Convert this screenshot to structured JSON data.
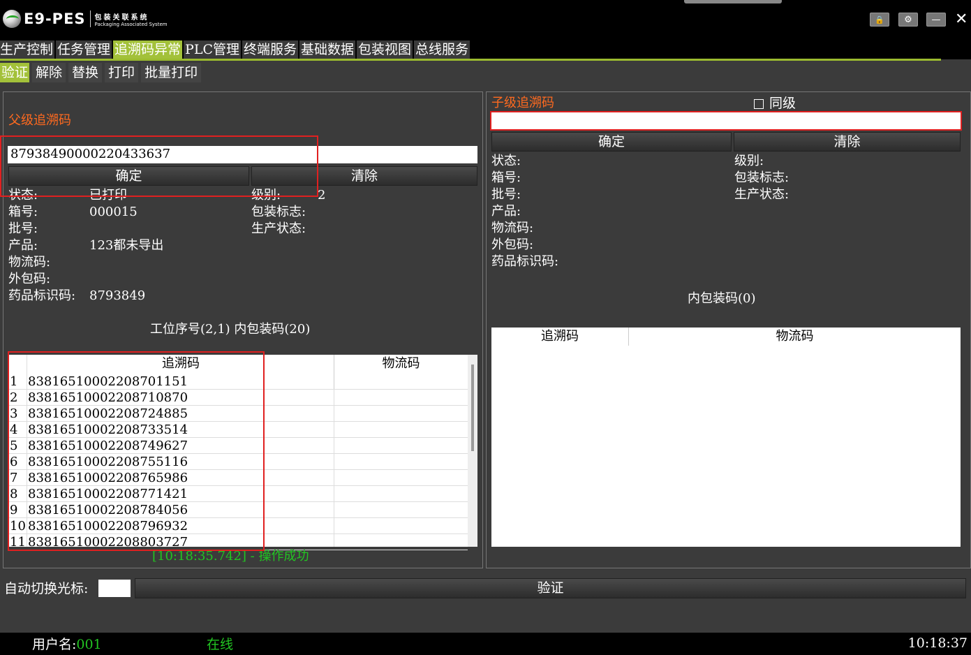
{
  "app": {
    "logo_text": "E9-PES",
    "logo_sub_cn": "包装关联系统",
    "logo_sub_en": "Packaging Associated System"
  },
  "window_controls": {
    "lock": "🔒",
    "settings": "⚙",
    "minimize": "—",
    "close": "✕"
  },
  "main_tabs": [
    "生产控制",
    "任务管理",
    "追溯码异常",
    "PLC管理",
    "终端服务",
    "基础数据",
    "包装视图",
    "总线服务"
  ],
  "sub_tabs": [
    "验证",
    "解除",
    "替换",
    "打印",
    "批量打印"
  ],
  "left": {
    "title": "父级追溯码",
    "input_value": "87938490000220433637",
    "confirm_label": "确定",
    "clear_label": "清除",
    "fields": {
      "status_label": "状态:",
      "status_value": "已打印",
      "box_label": "箱号:",
      "box_value": "000015",
      "batch_label": "批号:",
      "product_label": "产品:",
      "product_value": "123都未导出",
      "logistics_label": "物流码:",
      "outer_label": "外包码:",
      "drug_label": "药品标识码:",
      "drug_value": "8793849",
      "level_label": "级别:",
      "level_value": "2",
      "pack_flag_label": "包装标志:",
      "prod_status_label": "生产状态:"
    },
    "summary": "工位序号(2,1) 内包装码(20)",
    "table": {
      "columns": [
        "追溯码",
        "物流码"
      ],
      "rows": [
        {
          "n": "1",
          "code": "83816510002208701151"
        },
        {
          "n": "2",
          "code": "83816510002208710870"
        },
        {
          "n": "3",
          "code": "83816510002208724885"
        },
        {
          "n": "4",
          "code": "83816510002208733514"
        },
        {
          "n": "5",
          "code": "83816510002208749627"
        },
        {
          "n": "6",
          "code": "83816510002208755116"
        },
        {
          "n": "7",
          "code": "83816510002208765986"
        },
        {
          "n": "8",
          "code": "83816510002208771421"
        },
        {
          "n": "9",
          "code": "83816510002208784056"
        },
        {
          "n": "10",
          "code": "83816510002208796932"
        },
        {
          "n": "11",
          "code": "83816510002208803727"
        }
      ]
    },
    "status_message": "[10:18:35.742] - 操作成功"
  },
  "right": {
    "title": "子级追溯码",
    "same_level_label": "同级",
    "input_value": "",
    "confirm_label": "确定",
    "clear_label": "清除",
    "fields": {
      "status_label": "状态:",
      "box_label": "箱号:",
      "batch_label": "批号:",
      "product_label": "产品:",
      "logistics_label": "物流码:",
      "outer_label": "外包码:",
      "drug_label": "药品标识码:",
      "level_label": "级别:",
      "pack_flag_label": "包装标志:",
      "prod_status_label": "生产状态:"
    },
    "summary": "内包装码(0)",
    "table": {
      "columns": [
        "追溯码",
        "物流码"
      ]
    }
  },
  "bottom": {
    "auto_switch_label": "自动切换光标:",
    "verify_label": "验证"
  },
  "statusbar": {
    "user_label": "用户名:",
    "user_value": "001",
    "online": "在线",
    "time": "10:18:37"
  },
  "colors": {
    "accent_green": "#a3c13a",
    "orange": "#ff6a1f",
    "success": "#22c422",
    "highlight_red": "#e02020"
  }
}
